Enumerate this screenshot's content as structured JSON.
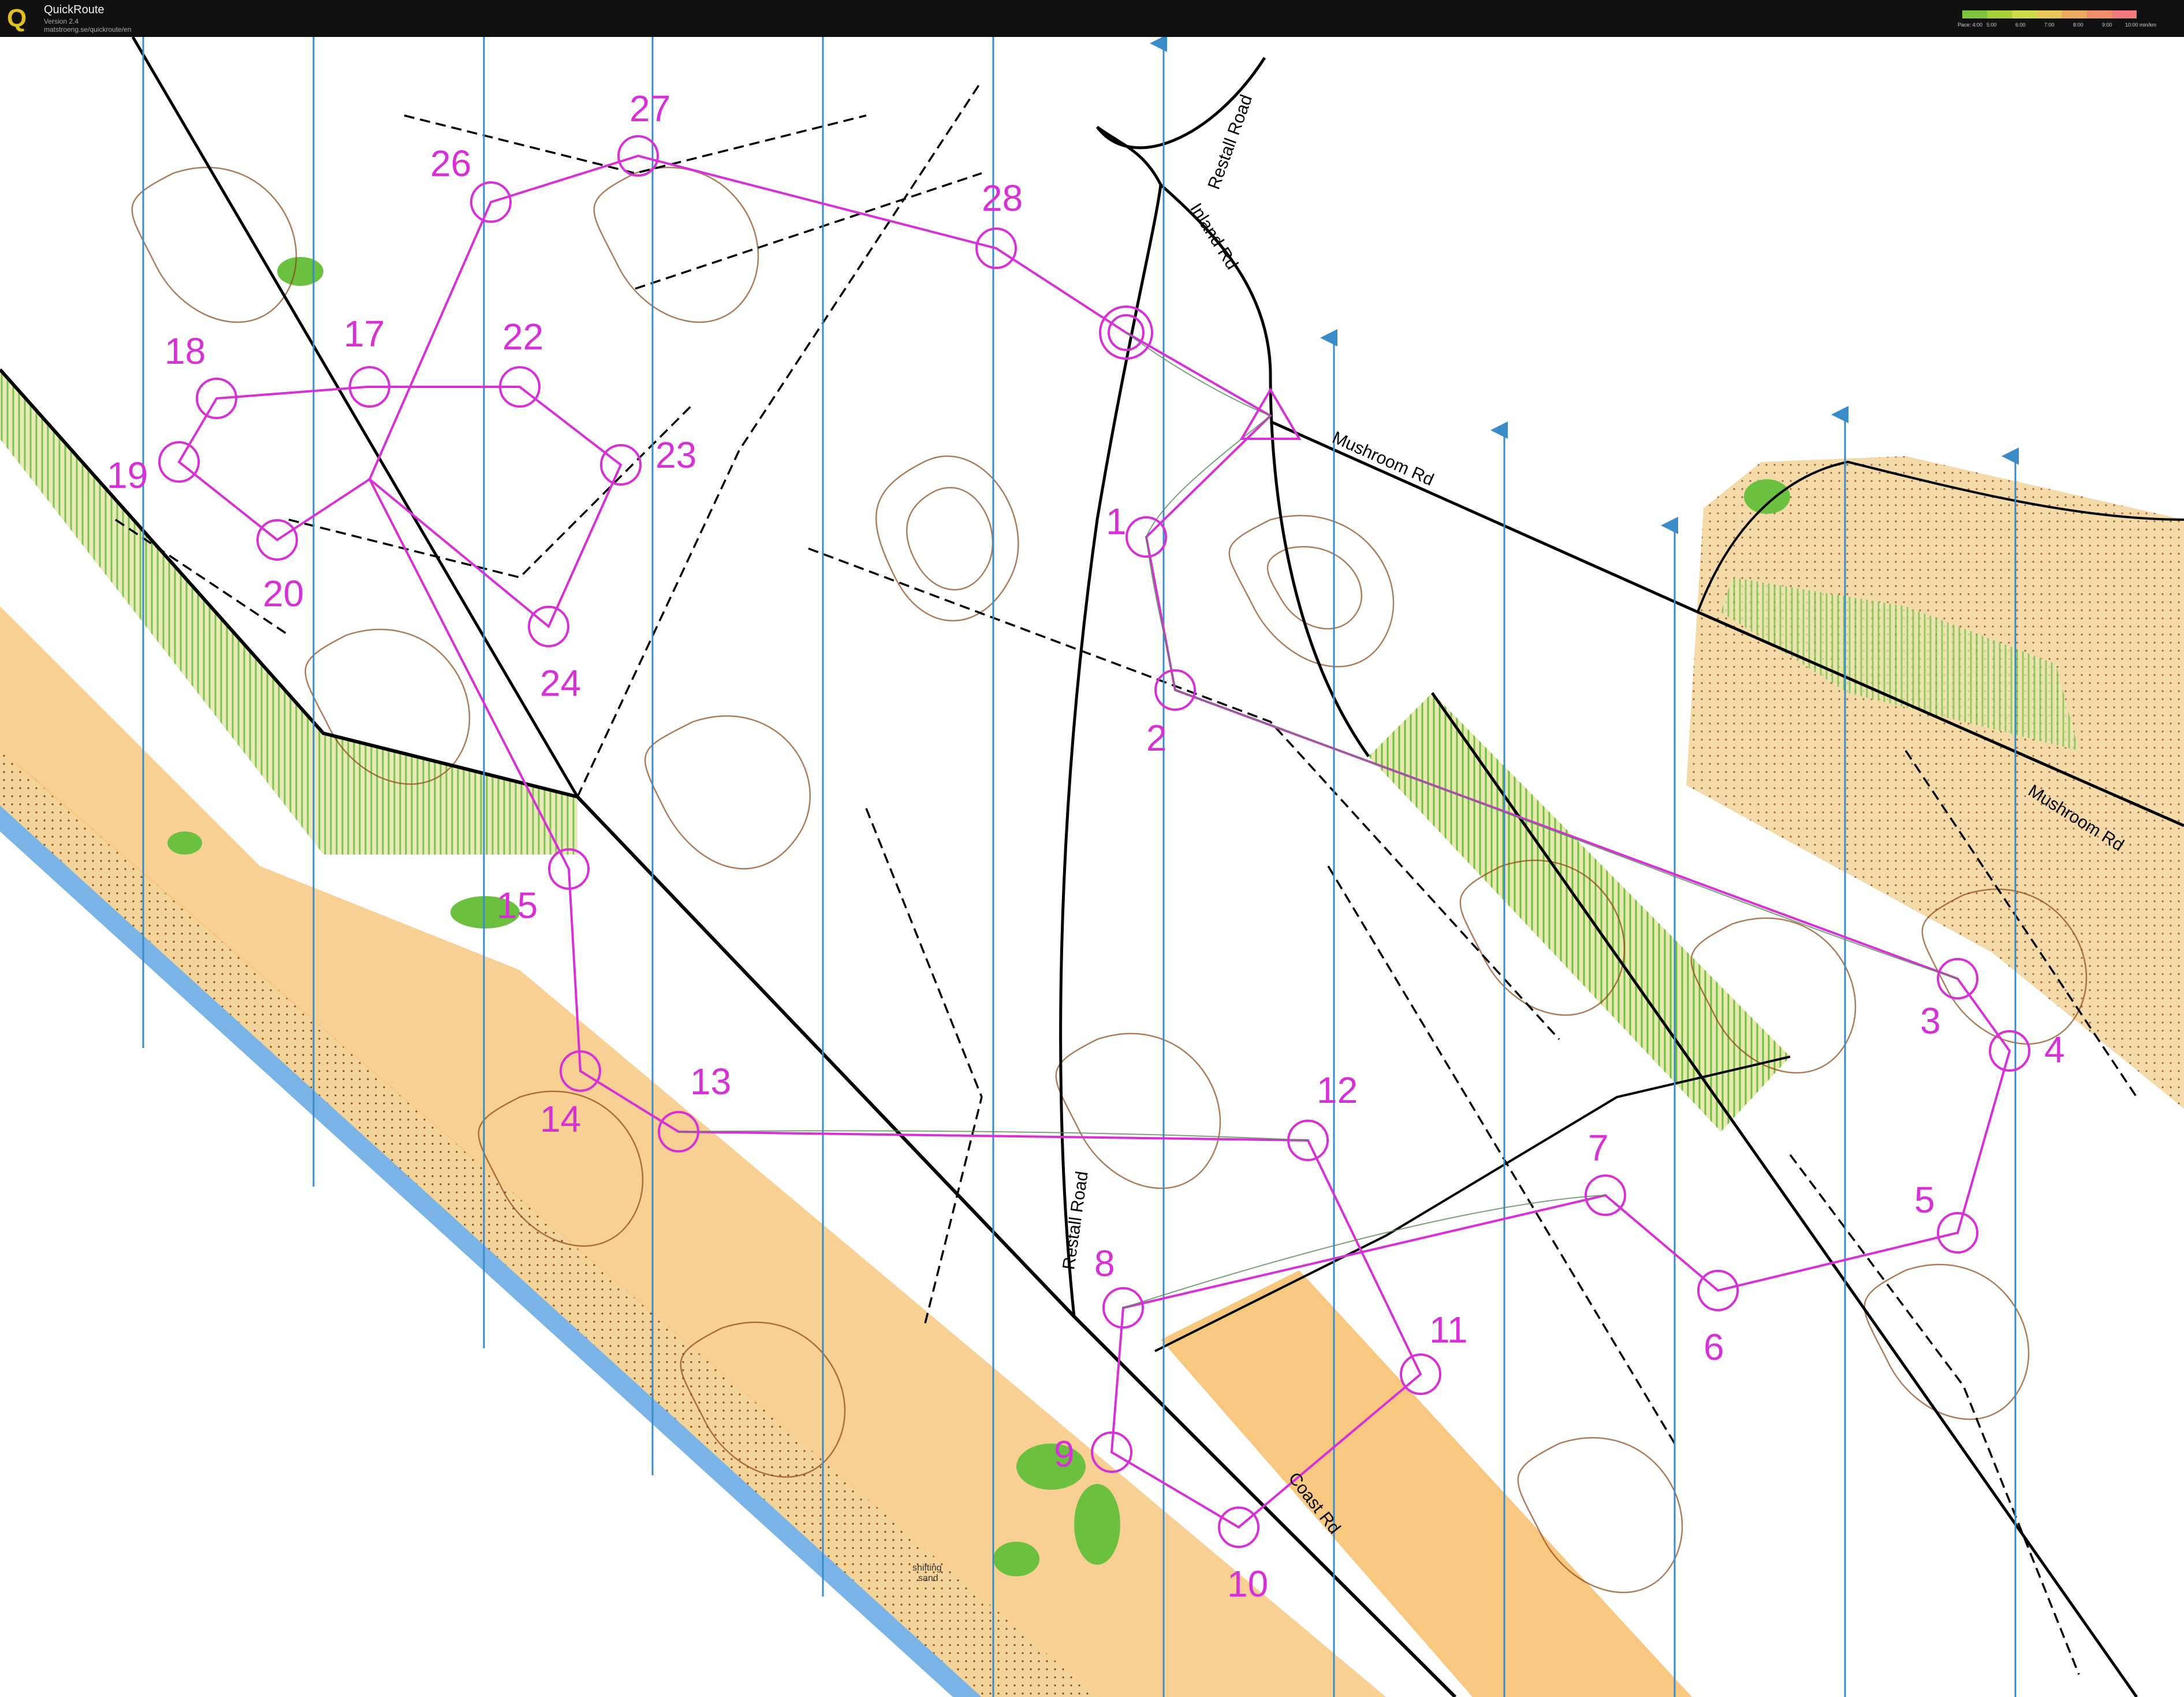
{
  "window": {
    "app_name": "QuickRoute",
    "app_version": "Version 2.4",
    "app_url": "matstroeng.se/quickroute/en"
  },
  "pace_legend": {
    "labels": [
      "Pace: 4:00",
      "5:00",
      "6:00",
      "7:00",
      "8:00",
      "9:00",
      "10:00 min/km"
    ],
    "colors": [
      "#7fc23c",
      "#a6cf3a",
      "#cfd94a",
      "#e8c85a",
      "#ecaa60",
      "#ef8f6a",
      "#f07a7a"
    ]
  },
  "map": {
    "colors": {
      "contour": "#8b4513",
      "route_line": "#d630d6",
      "north_lines": "#3a8cc8",
      "water": "#7ab4e6",
      "open_land": "#f8c880",
      "vegetation": "#6cc040",
      "roads": "#000000"
    },
    "road_labels": [
      "Restall Road",
      "Inland Rd",
      "Mushroom Rd",
      "Mushroom Rd",
      "Restall Road",
      "Coast Rd"
    ],
    "map_text": [
      "shifting",
      "sand"
    ],
    "controls": [
      {
        "number": "1"
      },
      {
        "number": "2"
      },
      {
        "number": "3"
      },
      {
        "number": "4"
      },
      {
        "number": "5"
      },
      {
        "number": "6"
      },
      {
        "number": "7"
      },
      {
        "number": "8"
      },
      {
        "number": "9"
      },
      {
        "number": "10"
      },
      {
        "number": "11"
      },
      {
        "number": "12"
      },
      {
        "number": "13"
      },
      {
        "number": "14"
      },
      {
        "number": "15"
      },
      {
        "number": "17"
      },
      {
        "number": "18"
      },
      {
        "number": "19"
      },
      {
        "number": "20"
      },
      {
        "number": "22"
      },
      {
        "number": "23"
      },
      {
        "number": "24"
      },
      {
        "number": "26"
      },
      {
        "number": "27"
      },
      {
        "number": "28"
      }
    ]
  }
}
